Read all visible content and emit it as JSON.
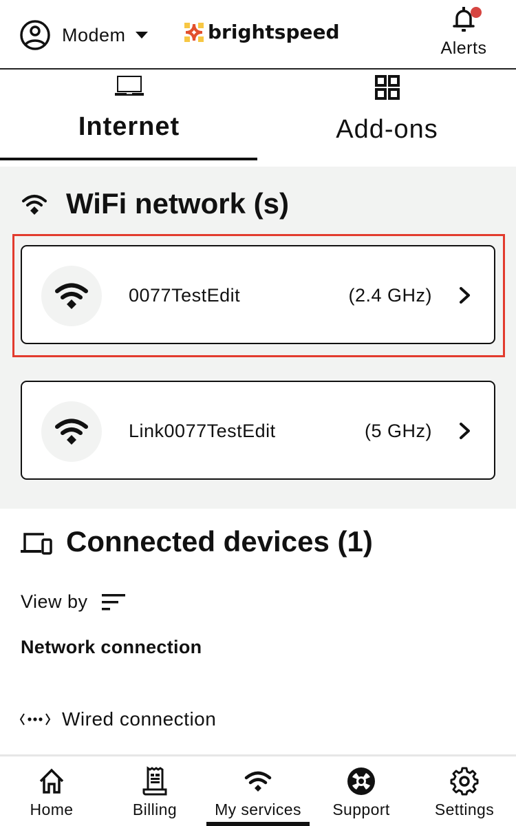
{
  "header": {
    "account_label": "Modem",
    "brand_name": "brightspeed",
    "alerts_label": "Alerts",
    "alert_dot_color": "#d64541",
    "brand_colors": {
      "yellow": "#f7c744",
      "orange": "#f08a34",
      "red": "#e2502d"
    }
  },
  "tabs": [
    {
      "label": "Internet",
      "icon": "laptop-icon",
      "active": true
    },
    {
      "label": "Add-ons",
      "icon": "grid-icon",
      "active": false
    }
  ],
  "wifi_section": {
    "title": "WiFi network (s)",
    "background": "#f2f3f2",
    "highlight_color": "#e23b2e",
    "networks": [
      {
        "name": "0077TestEdit",
        "band": "(2.4 GHz)",
        "highlighted": true
      },
      {
        "name": "Link0077TestEdit",
        "band": "(5 GHz)",
        "highlighted": false
      }
    ]
  },
  "devices_section": {
    "title": "Connected devices (1)",
    "view_by_label": "View by",
    "group_heading": "Network connection",
    "connection_type": "Wired connection"
  },
  "bottom_nav": {
    "items": [
      {
        "label": "Home",
        "icon": "home-icon"
      },
      {
        "label": "Billing",
        "icon": "receipt-icon"
      },
      {
        "label": "My services",
        "icon": "wifi-icon",
        "active": true
      },
      {
        "label": "Support",
        "icon": "lifebuoy-icon"
      },
      {
        "label": "Settings",
        "icon": "gear-icon"
      }
    ]
  }
}
